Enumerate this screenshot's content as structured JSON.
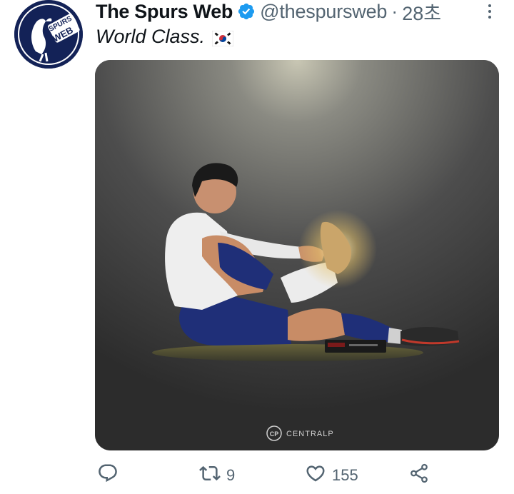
{
  "author": {
    "display_name": "The Spurs Web",
    "handle": "@thespursweb",
    "separator": "·",
    "timestamp": "28초",
    "avatar_text_top": "SPURS",
    "avatar_text_bottom": "WEB"
  },
  "tweet": {
    "text": "World Class.",
    "emoji_name": "south-korea-flag"
  },
  "media": {
    "watermark": "CENTRALP",
    "watermark_logo": "CP"
  },
  "actions": {
    "reply_count": "",
    "retweet_count": "9",
    "like_count": "155"
  },
  "colors": {
    "text_primary": "#0f1419",
    "text_secondary": "#536471",
    "verified": "#1d9bf0",
    "spurs_navy": "#132257"
  }
}
